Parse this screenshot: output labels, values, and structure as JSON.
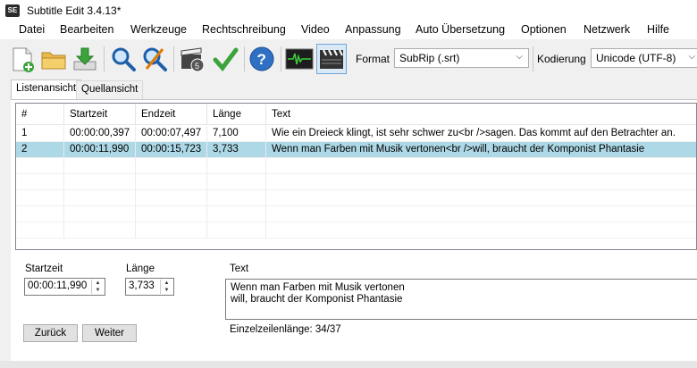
{
  "window": {
    "title": "Subtitle Edit 3.4.13*",
    "app_icon": "SE"
  },
  "menu": [
    "Datei",
    "Bearbeiten",
    "Werkzeuge",
    "Rechtschreibung",
    "Video",
    "Anpassung",
    "Auto Übersetzung",
    "Optionen",
    "Netzwerk",
    "Hilfe"
  ],
  "toolbar": {
    "format_label": "Format",
    "format_value": "SubRip (.srt)",
    "encoding_label": "Kodierung",
    "encoding_value": "Unicode (UTF-8)"
  },
  "tabs": [
    "Listenansicht",
    "Quellansicht"
  ],
  "table": {
    "headers": [
      "#",
      "Startzeit",
      "Endzeit",
      "Länge",
      "Text"
    ],
    "rows": [
      [
        "1",
        "00:00:00,397",
        "00:00:07,497",
        "7,100",
        "Wie ein Dreieck klingt, ist sehr schwer zu<br />sagen. Das kommt auf den Betrachter an."
      ],
      [
        "2",
        "00:00:11,990",
        "00:00:15,723",
        "3,733",
        "Wenn man Farben mit Musik vertonen<br />will, braucht der Komponist Phantasie"
      ]
    ],
    "selected_row": 1
  },
  "editor": {
    "start_label": "Startzeit",
    "start_value": "00:00:11,990",
    "duration_label": "Länge",
    "duration_value": "3,733",
    "text_label": "Text",
    "text_line1": "Wenn man Farben mit Musik vertonen",
    "text_line2": "will, braucht der Komponist Phantasie",
    "line_length_label": "Einzelzeilenlänge: 34/37",
    "back_button": "Zurück",
    "next_button": "Weiter"
  },
  "colors": {
    "selection": "#add8e6"
  }
}
